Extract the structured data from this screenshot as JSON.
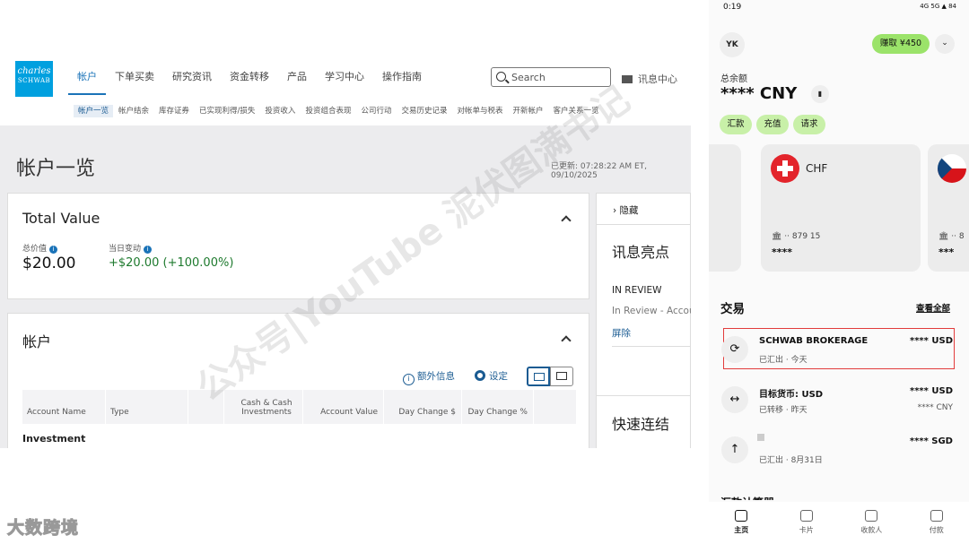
{
  "schwab": {
    "logo": {
      "line1": "charles",
      "line2": "SCHWAB"
    },
    "nav": [
      "帐户",
      "下单买卖",
      "研究资讯",
      "资金转移",
      "产品",
      "学习中心",
      "操作指南"
    ],
    "search_placeholder": "Search",
    "messages": "讯息中心",
    "subnav": [
      "帐户一览",
      "帐户结余",
      "库存证券",
      "已实现利得/损失",
      "投资收入",
      "投资组合表现",
      "公司行动",
      "交易历史记录",
      "对帐单与税表",
      "开新帐户",
      "客户关系一览"
    ],
    "page_title": "帐户一览",
    "updated": "已更新: 07:28:22 AM ET, 09/10/2025",
    "total_value": {
      "title": "Total Value",
      "total_label": "总价值",
      "total": "$20.00",
      "day_change_label": "当日变动",
      "day_change": "+$20.00 (+100.00%)"
    },
    "accounts": {
      "title": "帐户",
      "extra_info": "额外信息",
      "settings": "设定",
      "columns": [
        "Account Name",
        "Type",
        "",
        "Cash & Cash Investments",
        "Account Value",
        "Day Change $",
        "Day Change %"
      ],
      "group": "Investment"
    },
    "side": {
      "hide": "隐藏",
      "highlights": "讯息亮点",
      "status": "IN REVIEW",
      "status_text": "In Review - Accou",
      "remove": "屏除",
      "quick_links": "快速连结"
    }
  },
  "watermarks": {
    "diagonal": "公众号|YouTube 泥伏图满书记",
    "bottom_left": "大数跨境"
  },
  "phone": {
    "status_time": "0:19",
    "status_right": "4G  5G  ▲  84",
    "avatar": "YK",
    "earn_button": "赚取 ¥450",
    "balance_label": "总余额",
    "balance_value": "**** CNY",
    "actions": [
      "汇款",
      "充值",
      "请求"
    ],
    "card_center": {
      "currency": "CHF",
      "bank": "🏛 ·· 879 15",
      "amount": "****"
    },
    "card_right": {
      "bank": "🏛 ·· 8",
      "amount": "***"
    },
    "transactions_title": "交易",
    "see_all": "查看全部",
    "transactions": [
      {
        "icon": "⟳",
        "name": "SCHWAB BROKERAGE",
        "sub": "已汇出 · 今天",
        "amount": "**** USD",
        "amount2": ""
      },
      {
        "icon": "↔",
        "name": "目标货币: USD",
        "sub": "已转移 · 昨天",
        "amount": "**** USD",
        "amount2": "**** CNY"
      },
      {
        "icon": "↑",
        "name": "",
        "sub": "已汇出 · 8月31日",
        "amount": "**** SGD",
        "amount2": ""
      }
    ],
    "clipped_heading": "汇款计算器",
    "tabs": [
      "主页",
      "卡片",
      "收款人",
      "付款"
    ]
  }
}
